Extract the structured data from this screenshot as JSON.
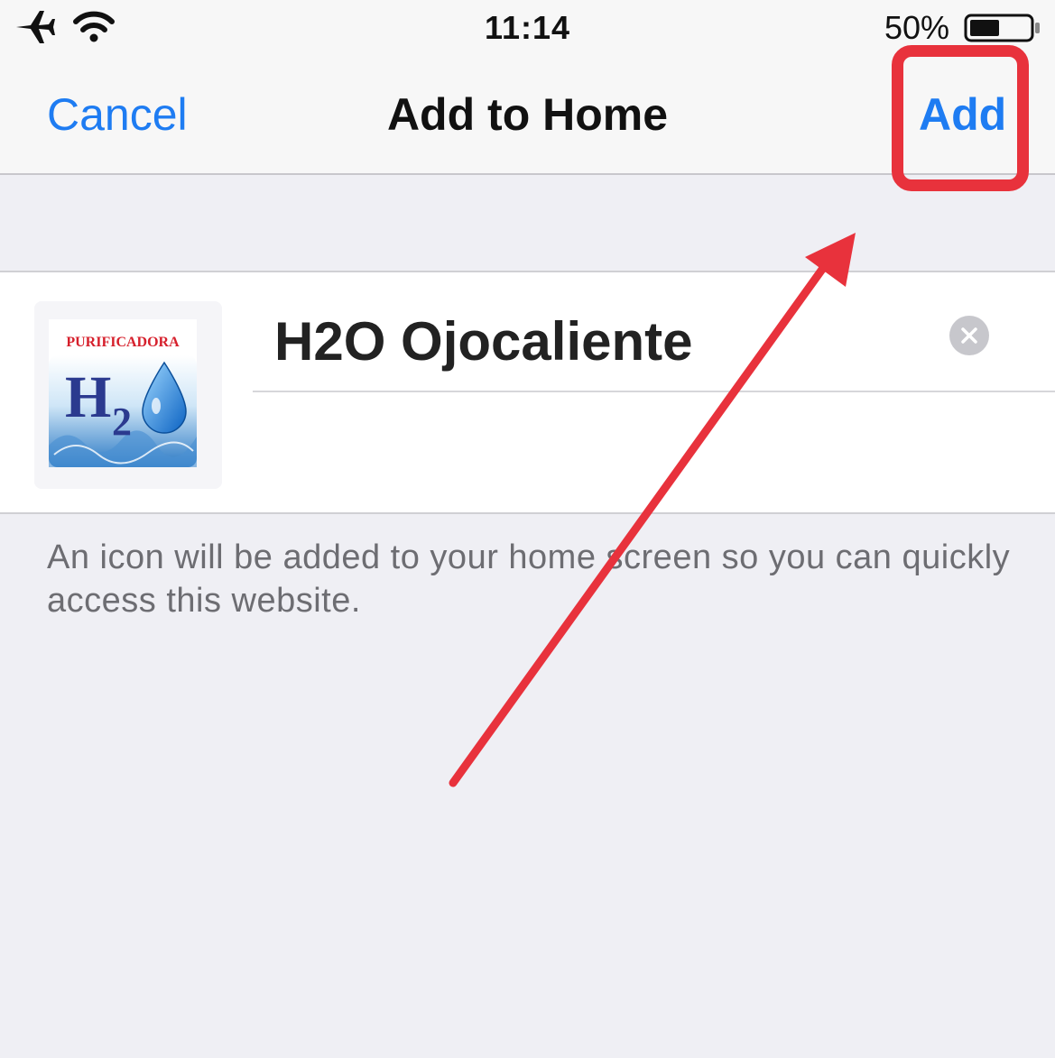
{
  "status_bar": {
    "time": "11:14",
    "battery_percent": "50%",
    "battery_level": 0.5,
    "icons": [
      "airplane-icon",
      "wifi-icon",
      "battery-icon"
    ]
  },
  "nav": {
    "cancel_label": "Cancel",
    "title": "Add to Home",
    "add_label": "Add"
  },
  "form": {
    "app_icon": {
      "name": "app-icon",
      "logo_top_text": "PURIFICADORA",
      "logo_main_text": "H",
      "logo_subscript": "2"
    },
    "name_value": "H2O Ojocaliente",
    "clear_icon": "clear-icon"
  },
  "footer": {
    "note": "An icon will be added to your home screen so you can quickly access this website."
  },
  "annotation": {
    "color": "#e8323c",
    "highlight_target": "add-button"
  },
  "colors": {
    "accent": "#1e7cf2",
    "background": "#efeff4",
    "annotation": "#e8323c"
  }
}
